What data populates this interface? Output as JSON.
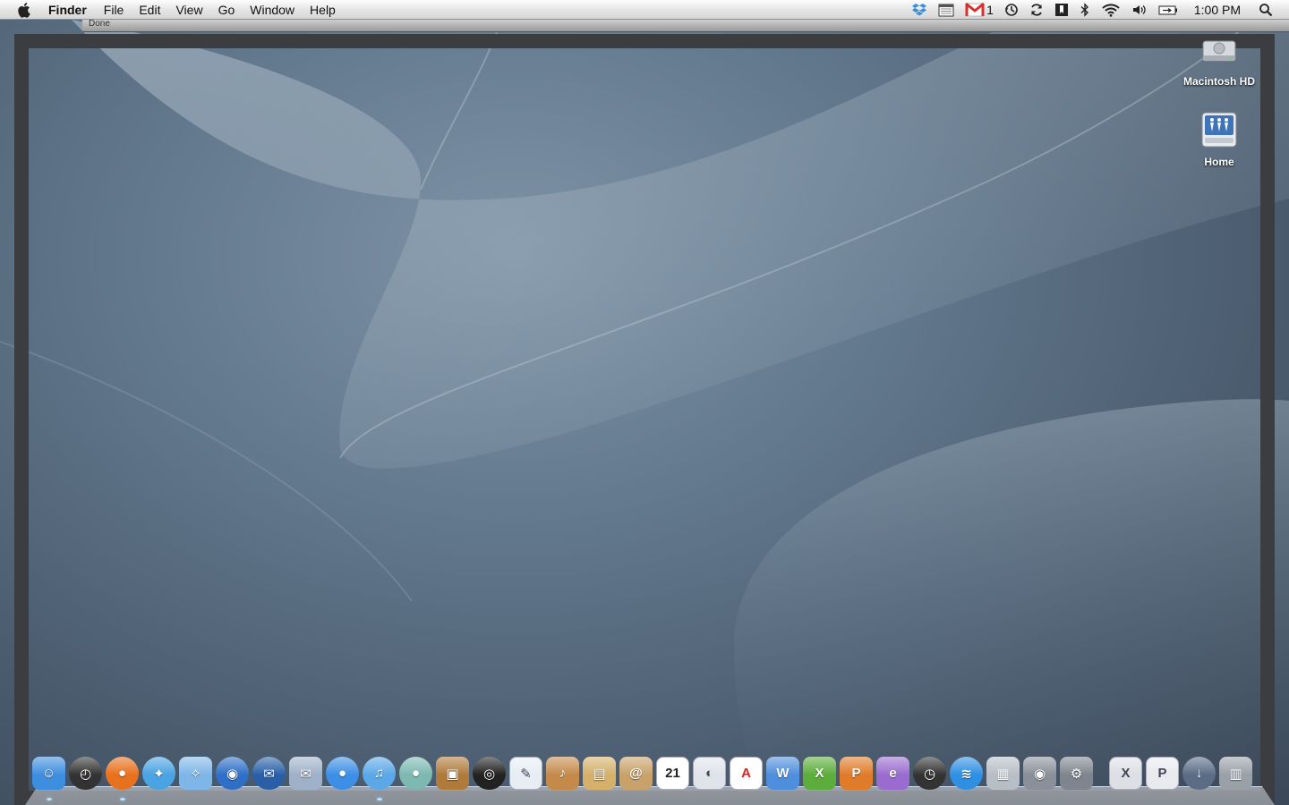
{
  "menubar": {
    "app_name": "Finder",
    "menus": [
      "File",
      "Edit",
      "View",
      "Go",
      "Window",
      "Help"
    ],
    "status_icons": [
      "dropbox-icon",
      "calendar-icon",
      "gmail-icon",
      "time-machine-icon",
      "sync-icon",
      "bookmark-icon",
      "bluetooth-icon",
      "wifi-icon",
      "volume-icon",
      "battery-icon"
    ],
    "gmail_count": "1",
    "clock": "1:00 PM"
  },
  "strip": {
    "status": "Done"
  },
  "desktop": {
    "icons": [
      {
        "id": "macintosh-hd",
        "label": "Macintosh HD",
        "icon": "hard-drive-icon"
      },
      {
        "id": "home",
        "label": "Home",
        "icon": "home-network-icon"
      }
    ]
  },
  "dock": {
    "items": [
      {
        "name": "finder",
        "glyph": "☺",
        "bg": "#3e8ee0",
        "running": true
      },
      {
        "name": "dashboard",
        "glyph": "◴",
        "bg": "#333333",
        "round": true
      },
      {
        "name": "firefox",
        "glyph": "●",
        "bg": "#e8711e",
        "round": true,
        "running": true
      },
      {
        "name": "safari",
        "glyph": "✦",
        "bg": "#4aa3e2",
        "round": true
      },
      {
        "name": "compass",
        "glyph": "✧",
        "bg": "#7fb6e8"
      },
      {
        "name": "camino",
        "glyph": "◉",
        "bg": "#2f6fc7",
        "round": true
      },
      {
        "name": "thunderbird",
        "glyph": "✉",
        "bg": "#2a5fa8",
        "round": true
      },
      {
        "name": "mail",
        "glyph": "✉",
        "bg": "#9fb1c9"
      },
      {
        "name": "ichat",
        "glyph": "●",
        "bg": "#3d8fe6",
        "round": true
      },
      {
        "name": "itunes",
        "glyph": "♫",
        "bg": "#5ba8e8",
        "round": true,
        "running": true
      },
      {
        "name": "egg",
        "glyph": "●",
        "bg": "#7db8b1",
        "round": true
      },
      {
        "name": "iphoto",
        "glyph": "▣",
        "bg": "#b07a3a"
      },
      {
        "name": "aperture",
        "glyph": "◎",
        "bg": "#222222",
        "round": true
      },
      {
        "name": "quill",
        "glyph": "✎",
        "bg": "#e6eef4"
      },
      {
        "name": "garageband",
        "glyph": "♪",
        "bg": "#c48a4a"
      },
      {
        "name": "iwork",
        "glyph": "▤",
        "bg": "#d4b06a"
      },
      {
        "name": "address-book",
        "glyph": "@",
        "bg": "#c8a26a"
      },
      {
        "name": "ical",
        "glyph": "21",
        "bg": "#ffffff"
      },
      {
        "name": "preview",
        "glyph": "◐",
        "bg": "#dfe4ea"
      },
      {
        "name": "acrobat",
        "glyph": "A",
        "bg": "#ffffff"
      },
      {
        "name": "word",
        "glyph": "W",
        "bg": "#4f8edc"
      },
      {
        "name": "excel",
        "glyph": "X",
        "bg": "#5cad3b"
      },
      {
        "name": "powerpoint",
        "glyph": "P",
        "bg": "#e07b2a"
      },
      {
        "name": "entourage",
        "glyph": "e",
        "bg": "#9a6ccf"
      },
      {
        "name": "time-machine",
        "glyph": "◷",
        "bg": "#333333",
        "round": true
      },
      {
        "name": "airport-utility",
        "glyph": "≋",
        "bg": "#2f8fe3",
        "round": true
      },
      {
        "name": "calculator",
        "glyph": "▦",
        "bg": "#b8bec6"
      },
      {
        "name": "dvd-player",
        "glyph": "◉",
        "bg": "#8a9099"
      },
      {
        "name": "system-preferences",
        "glyph": "⚙",
        "bg": "#7e858e"
      },
      {
        "name": "xls-document",
        "glyph": "X",
        "bg": "#dcdfe3",
        "sep": true
      },
      {
        "name": "pdf-document",
        "glyph": "P",
        "bg": "#e8eaee"
      },
      {
        "name": "downloads-stack",
        "glyph": "↓",
        "bg": "#5b6c85",
        "round": true
      },
      {
        "name": "trash",
        "glyph": "▥",
        "bg": "#9aa0a8"
      }
    ]
  }
}
